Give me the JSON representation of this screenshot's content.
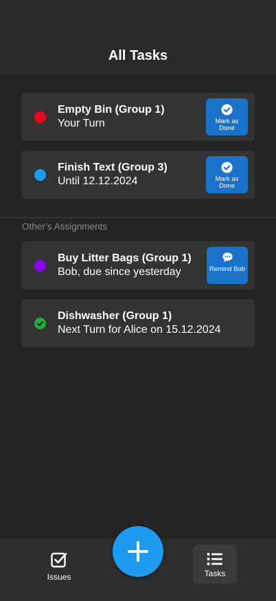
{
  "header": {
    "title": "All Tasks"
  },
  "my_tasks": [
    {
      "title": "Empty Bin (Group 1)",
      "subtitle": "Your Turn",
      "dot_color": "#e8001c",
      "action_label": "Mark as Done",
      "action_icon": "check-circle-icon"
    },
    {
      "title": "Finish Text (Group 3)",
      "subtitle": "Until 12.12.2024",
      "dot_color": "#1a9cf0",
      "action_label": "Mark as Done",
      "action_icon": "check-circle-icon"
    }
  ],
  "others_section": {
    "label": "Other’s Assignments"
  },
  "other_tasks": [
    {
      "title": "Buy Litter Bags (Group 1)",
      "subtitle": "Bob, due since yesterday",
      "dot_color": "#8a00f0",
      "action_label": "Remind Bob",
      "action_icon": "chat-bubble-icon"
    },
    {
      "title": "Dishwasher (Group 1)",
      "subtitle": "Next Turn for Alice on 15.12.2024",
      "dot_color": "#1faa3a",
      "status_icon": "check-circle-icon"
    }
  ],
  "nav": {
    "issues_label": "Issues",
    "issues_icon": "checkbox-icon",
    "tasks_label": "Tasks",
    "tasks_icon": "list-icon",
    "fab_icon": "plus-icon",
    "active": "Tasks"
  },
  "colors": {
    "accent": "#1e9bf0",
    "button_blue": "#1a73c9",
    "background": "#242424",
    "card": "#333333"
  }
}
